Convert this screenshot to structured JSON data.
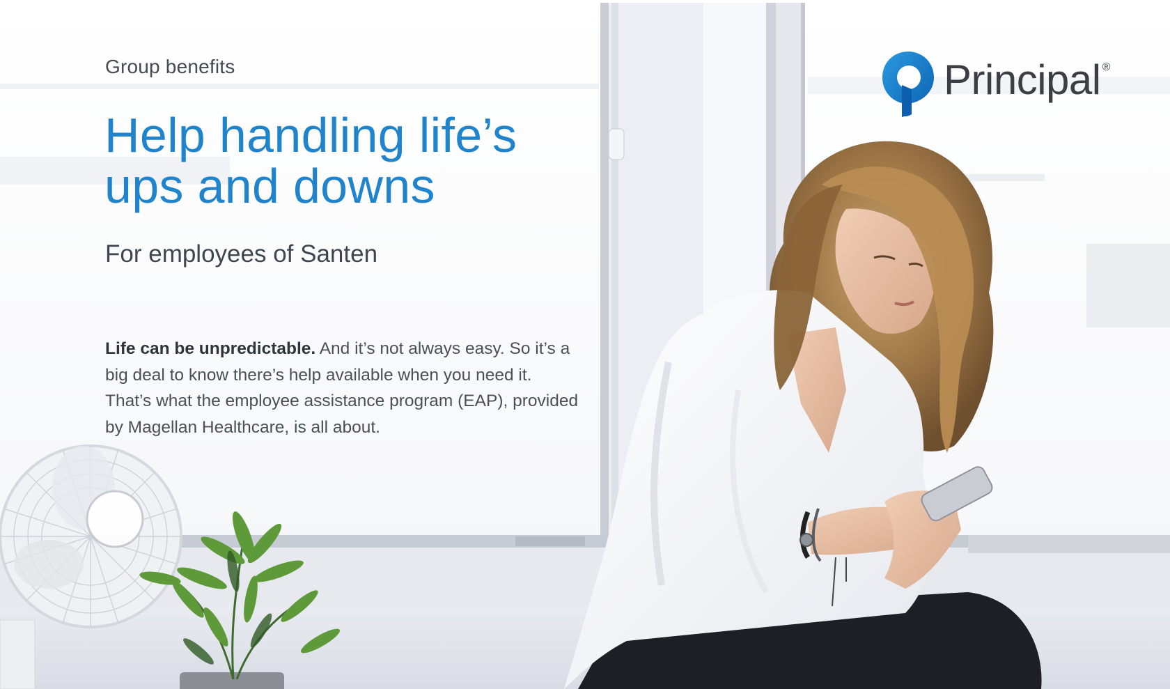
{
  "brand": {
    "name": "Principal",
    "registered_mark": "®",
    "accent_color": "#1f84cc",
    "logo_icon": "principal-p-logo-icon"
  },
  "cover": {
    "eyebrow": "Group benefits",
    "headline_line1": "Help handling life’s",
    "headline_line2": "ups and downs",
    "subhead": "For employees of Santen",
    "intro_bold": "Life can be unpredictable.",
    "intro_rest": " And it’s not always easy. So it’s a big deal to know there’s help available when you need it. That’s what the employee assistance program (EAP), provided by Magellan Healthcare, is all about."
  },
  "photo": {
    "subject": "woman-using-phone-by-window"
  }
}
